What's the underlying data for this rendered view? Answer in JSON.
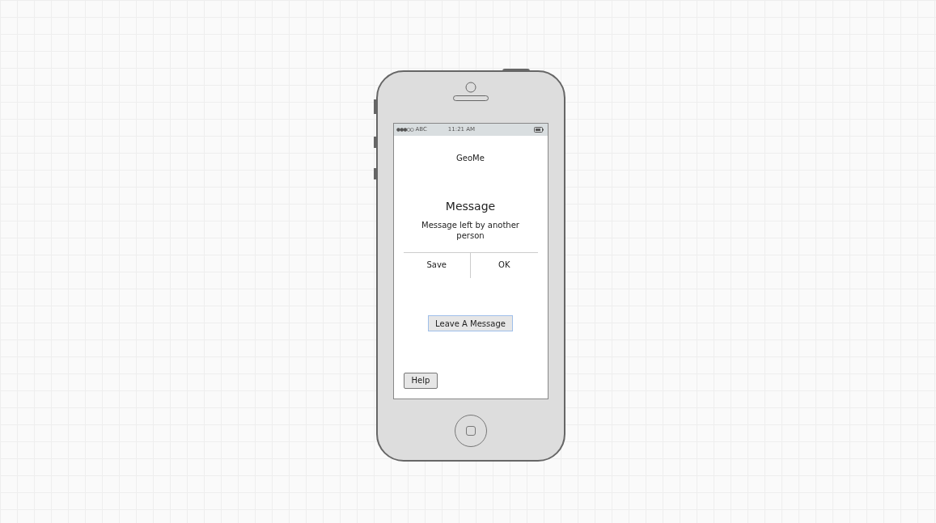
{
  "status_bar": {
    "carrier": "ABC",
    "time": "11:21 AM"
  },
  "app_title": "GeoMe",
  "dialog": {
    "title": "Message",
    "body": "Message left by another person",
    "buttons": [
      "Save",
      "OK"
    ]
  },
  "primary_button": {
    "label": "Leave A Message",
    "focused": true
  },
  "help_button": {
    "label": "Help"
  }
}
